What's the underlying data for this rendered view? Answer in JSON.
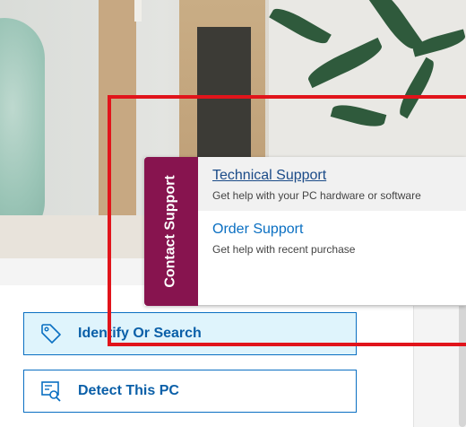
{
  "contact_support": {
    "tab_label": "Contact Support",
    "items": [
      {
        "title": "Technical Support",
        "desc": "Get help with your PC hardware or software"
      },
      {
        "title": "Order Support",
        "desc": "Get help with recent purchase"
      }
    ]
  },
  "actions": {
    "identify_label": "Identify Or Search",
    "detect_label": "Detect This PC"
  },
  "icons": {
    "identify": "tag-icon",
    "detect": "pc-scan-icon"
  },
  "colors": {
    "tab_bg": "#87144f",
    "link": "#0a6fc2",
    "identify_bg": "#dff4fc",
    "highlight": "#e1141b"
  }
}
